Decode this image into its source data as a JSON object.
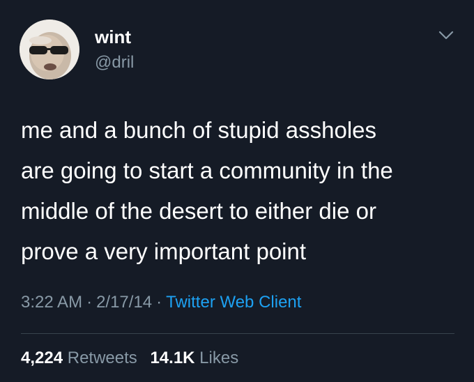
{
  "user": {
    "display_name": "wint",
    "handle": "@dril"
  },
  "tweet": {
    "text": "me and a bunch of stupid assholes\nare going to start a community in the\nmiddle of the desert to either die or\nprove a very important point",
    "time": "3:22 AM",
    "date": "2/17/14",
    "source": "Twitter Web Client",
    "separator": "·"
  },
  "stats": {
    "retweets_count": "4,224",
    "retweets_label": "Retweets",
    "likes_count": "14.1K",
    "likes_label": "Likes"
  },
  "icons": {
    "menu": "chevron-down-icon",
    "avatar": "avatar"
  },
  "colors": {
    "background": "#151b26",
    "text": "#ffffff",
    "secondary_text": "#8899a6",
    "link": "#1da1f2",
    "divider": "#38444d"
  }
}
